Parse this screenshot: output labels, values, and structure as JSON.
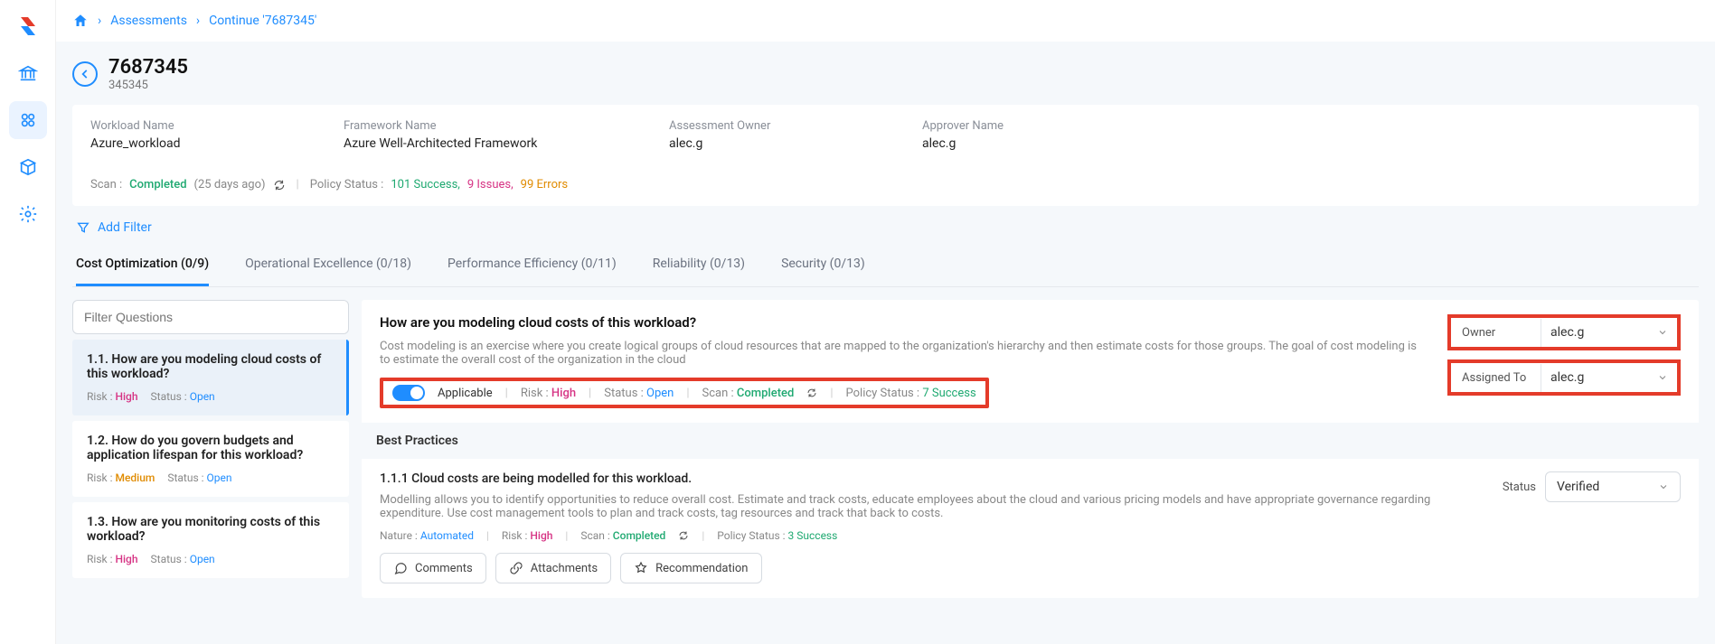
{
  "breadcrumb": {
    "assessments": "Assessments",
    "current": "Continue '7687345'"
  },
  "page": {
    "title": "7687345",
    "subtitle": "345345"
  },
  "info": {
    "workload_label": "Workload Name",
    "workload_value": "Azure_workload",
    "framework_label": "Framework Name",
    "framework_value": "Azure Well-Architected Framework",
    "owner_label": "Assessment Owner",
    "owner_value": "alec.g",
    "approver_label": "Approver Name",
    "approver_value": "alec.g"
  },
  "scan": {
    "label": "Scan :",
    "status": "Completed",
    "age": "(25 days ago)",
    "policy_label": "Policy Status :",
    "success": "101 Success,",
    "issues": "9 Issues,",
    "errors": "99 Errors"
  },
  "filter": {
    "add": "Add Filter"
  },
  "tabs": {
    "t1": "Cost Optimization (0/9)",
    "t2": "Operational Excellence (0/18)",
    "t3": "Performance Efficiency (0/11)",
    "t4": "Reliability (0/13)",
    "t5": "Security (0/13)"
  },
  "search": {
    "placeholder": "Filter Questions"
  },
  "questions": {
    "q1": {
      "title": "1.1. How are you modeling cloud costs of this workload?",
      "risk_label": "Risk :",
      "risk": "High",
      "status_label": "Status :",
      "status": "Open"
    },
    "q2": {
      "title": "1.2. How do you govern budgets and application lifespan for this workload?",
      "risk_label": "Risk :",
      "risk": "Medium",
      "status_label": "Status :",
      "status": "Open"
    },
    "q3": {
      "title": "1.3. How are you monitoring costs of this workload?",
      "risk_label": "Risk :",
      "risk": "High",
      "status_label": "Status :",
      "status": "Open"
    }
  },
  "detail": {
    "title": "How are you modeling cloud costs of this workload?",
    "desc": "Cost modeling is an exercise where you create logical groups of cloud resources that are mapped to the organization's hierarchy and then estimate costs for those groups. The goal of cost modeling is to estimate the overall cost of the organization in the cloud",
    "applicable": "Applicable",
    "risk_label": "Risk :",
    "risk": "High",
    "status_label": "Status :",
    "status": "Open",
    "scan_label": "Scan :",
    "scan": "Completed",
    "policy_label": "Policy Status :",
    "policy": "7 Success",
    "owner_label": "Owner",
    "owner_value": "alec.g",
    "assigned_label": "Assigned To",
    "assigned_value": "alec.g"
  },
  "bp": {
    "header": "Best Practices",
    "title": "1.1.1 Cloud costs are being modelled for this workload.",
    "desc": "Modelling allows you to identify opportunities to reduce overall cost. Estimate and track costs, educate employees about the cloud and various pricing models and have appropriate governance regarding expenditure. Use cost management tools to plan and track costs, tag resources and track that back to costs.",
    "nature_label": "Nature :",
    "nature": "Automated",
    "risk_label": "Risk :",
    "risk": "High",
    "scan_label": "Scan :",
    "scan": "Completed",
    "policy_label": "Policy Status :",
    "policy": "3 Success",
    "status_label": "Status",
    "status_value": "Verified",
    "comments": "Comments",
    "attachments": "Attachments",
    "recommendation": "Recommendation"
  }
}
